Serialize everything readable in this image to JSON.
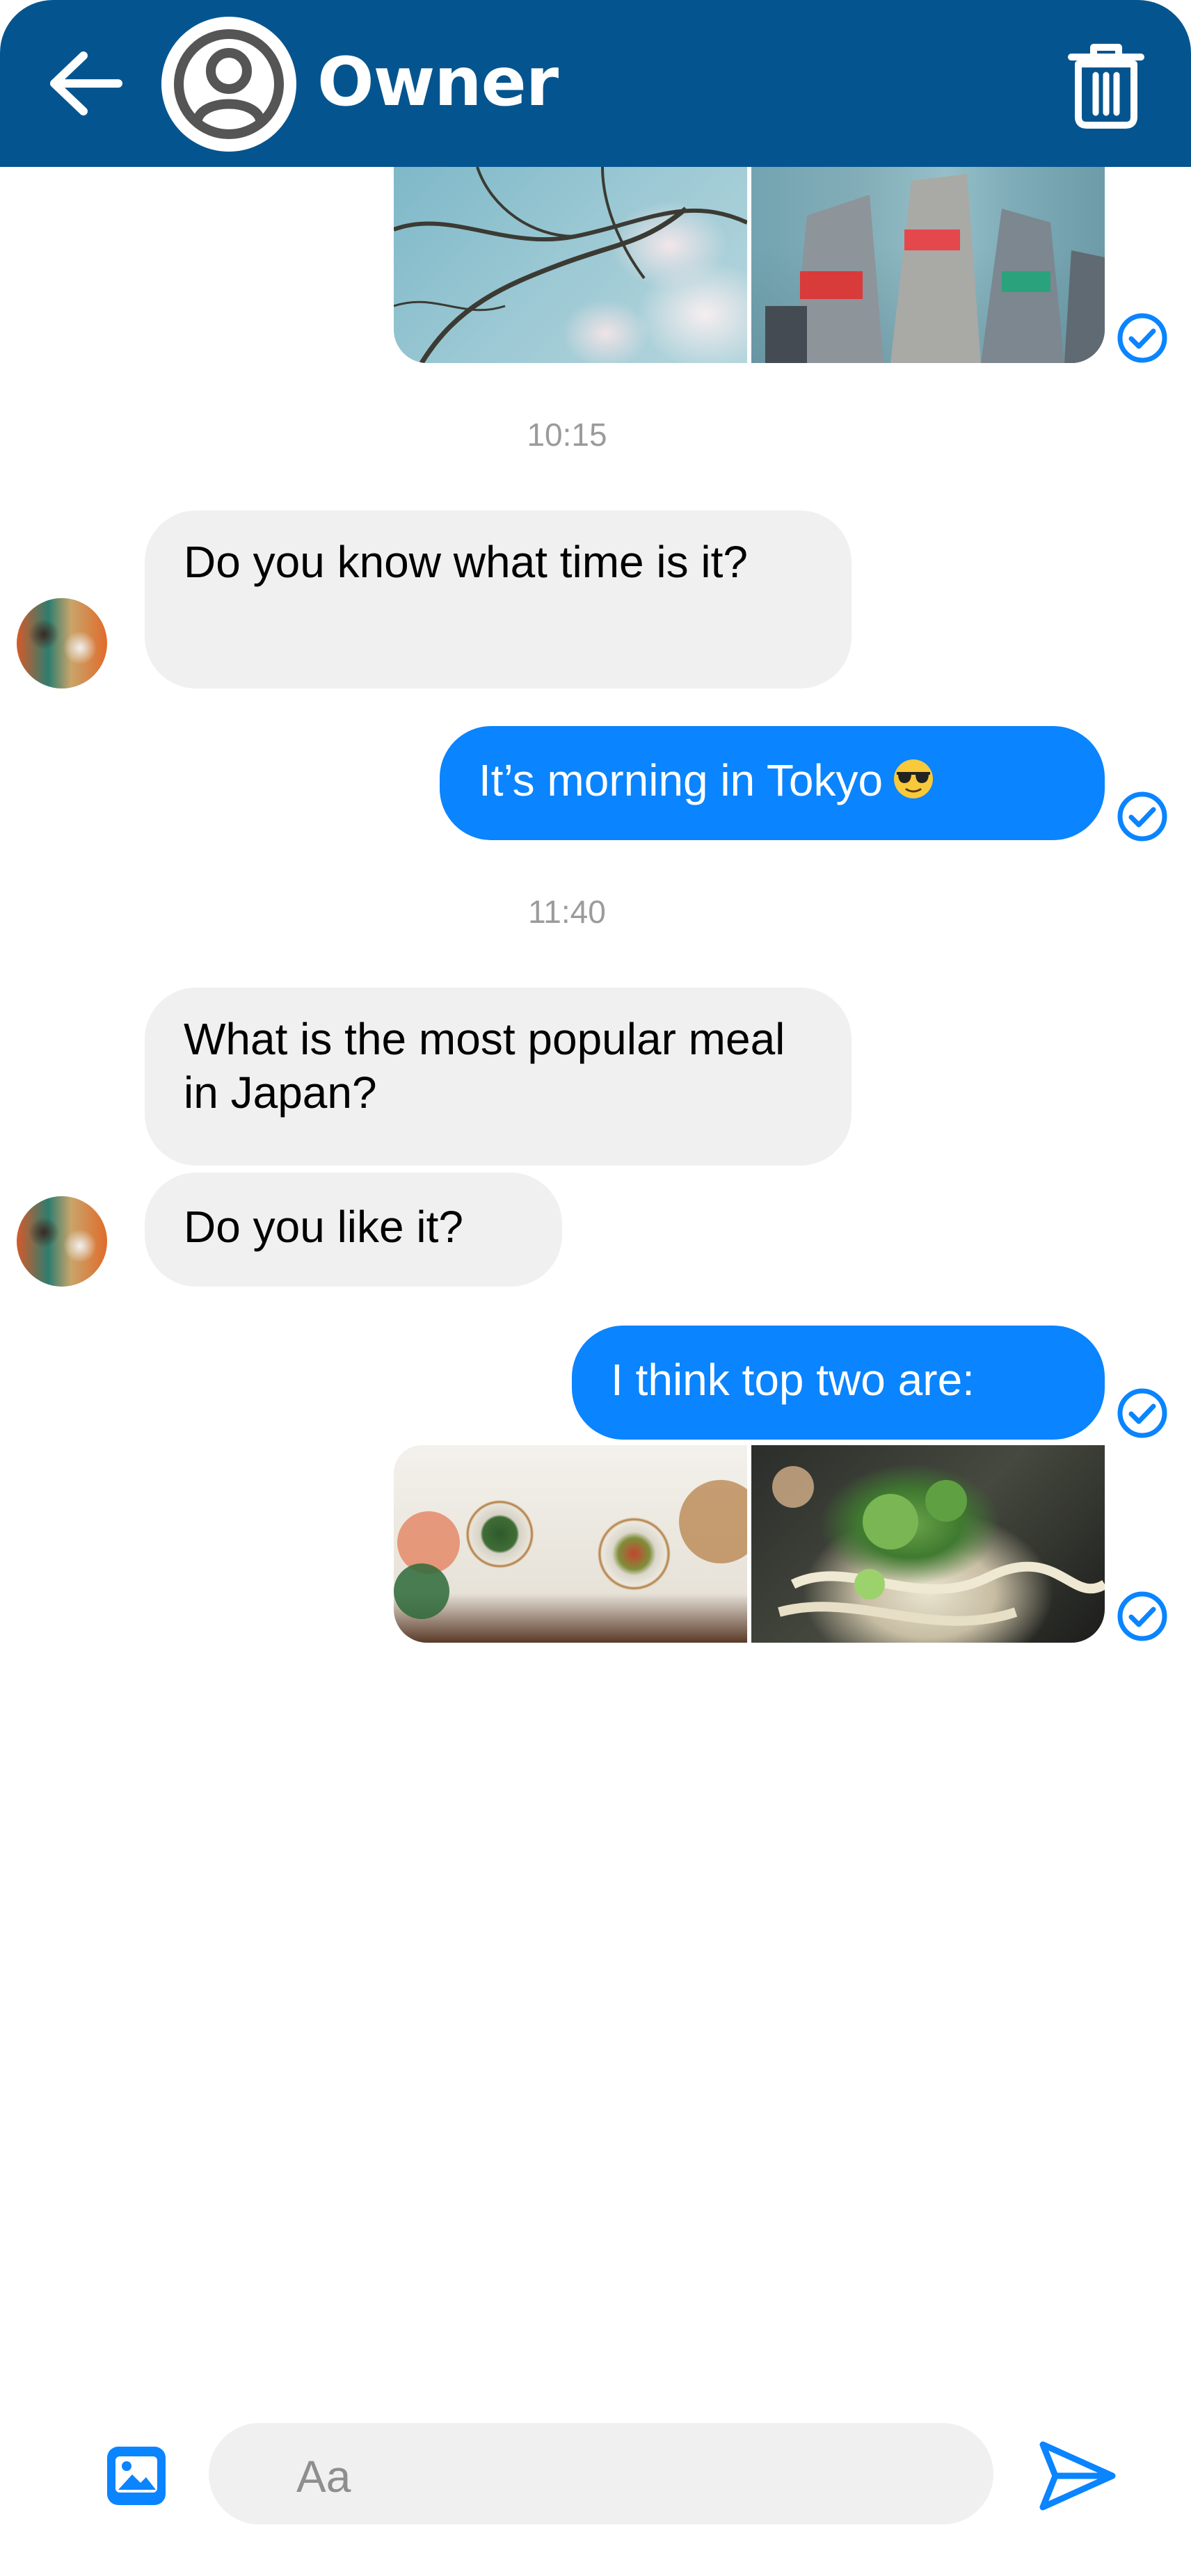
{
  "header": {
    "title": "Owner",
    "back_icon": "arrow-left-icon",
    "avatar_icon": "user-circle-icon",
    "trash_icon": "trash-icon",
    "bg_color": "#04558f"
  },
  "messages": {
    "timestamp_1": "10:15",
    "incoming_1": "Do you know what time is it?",
    "outgoing_1": "It’s morning in Tokyo",
    "outgoing_1_emoji": "sunglasses-emoji",
    "timestamp_2": "11:40",
    "incoming_2": "What is the most popular meal in Japan?",
    "incoming_3": "Do you like it?",
    "outgoing_2": "I think top two are:"
  },
  "composer": {
    "placeholder": "Aa",
    "photo_icon": "image-icon",
    "send_icon": "send-icon"
  },
  "colors": {
    "outgoing_bubble": "#0a84ff",
    "incoming_bubble": "#f0f0f0",
    "accent": "#0a84ff"
  }
}
